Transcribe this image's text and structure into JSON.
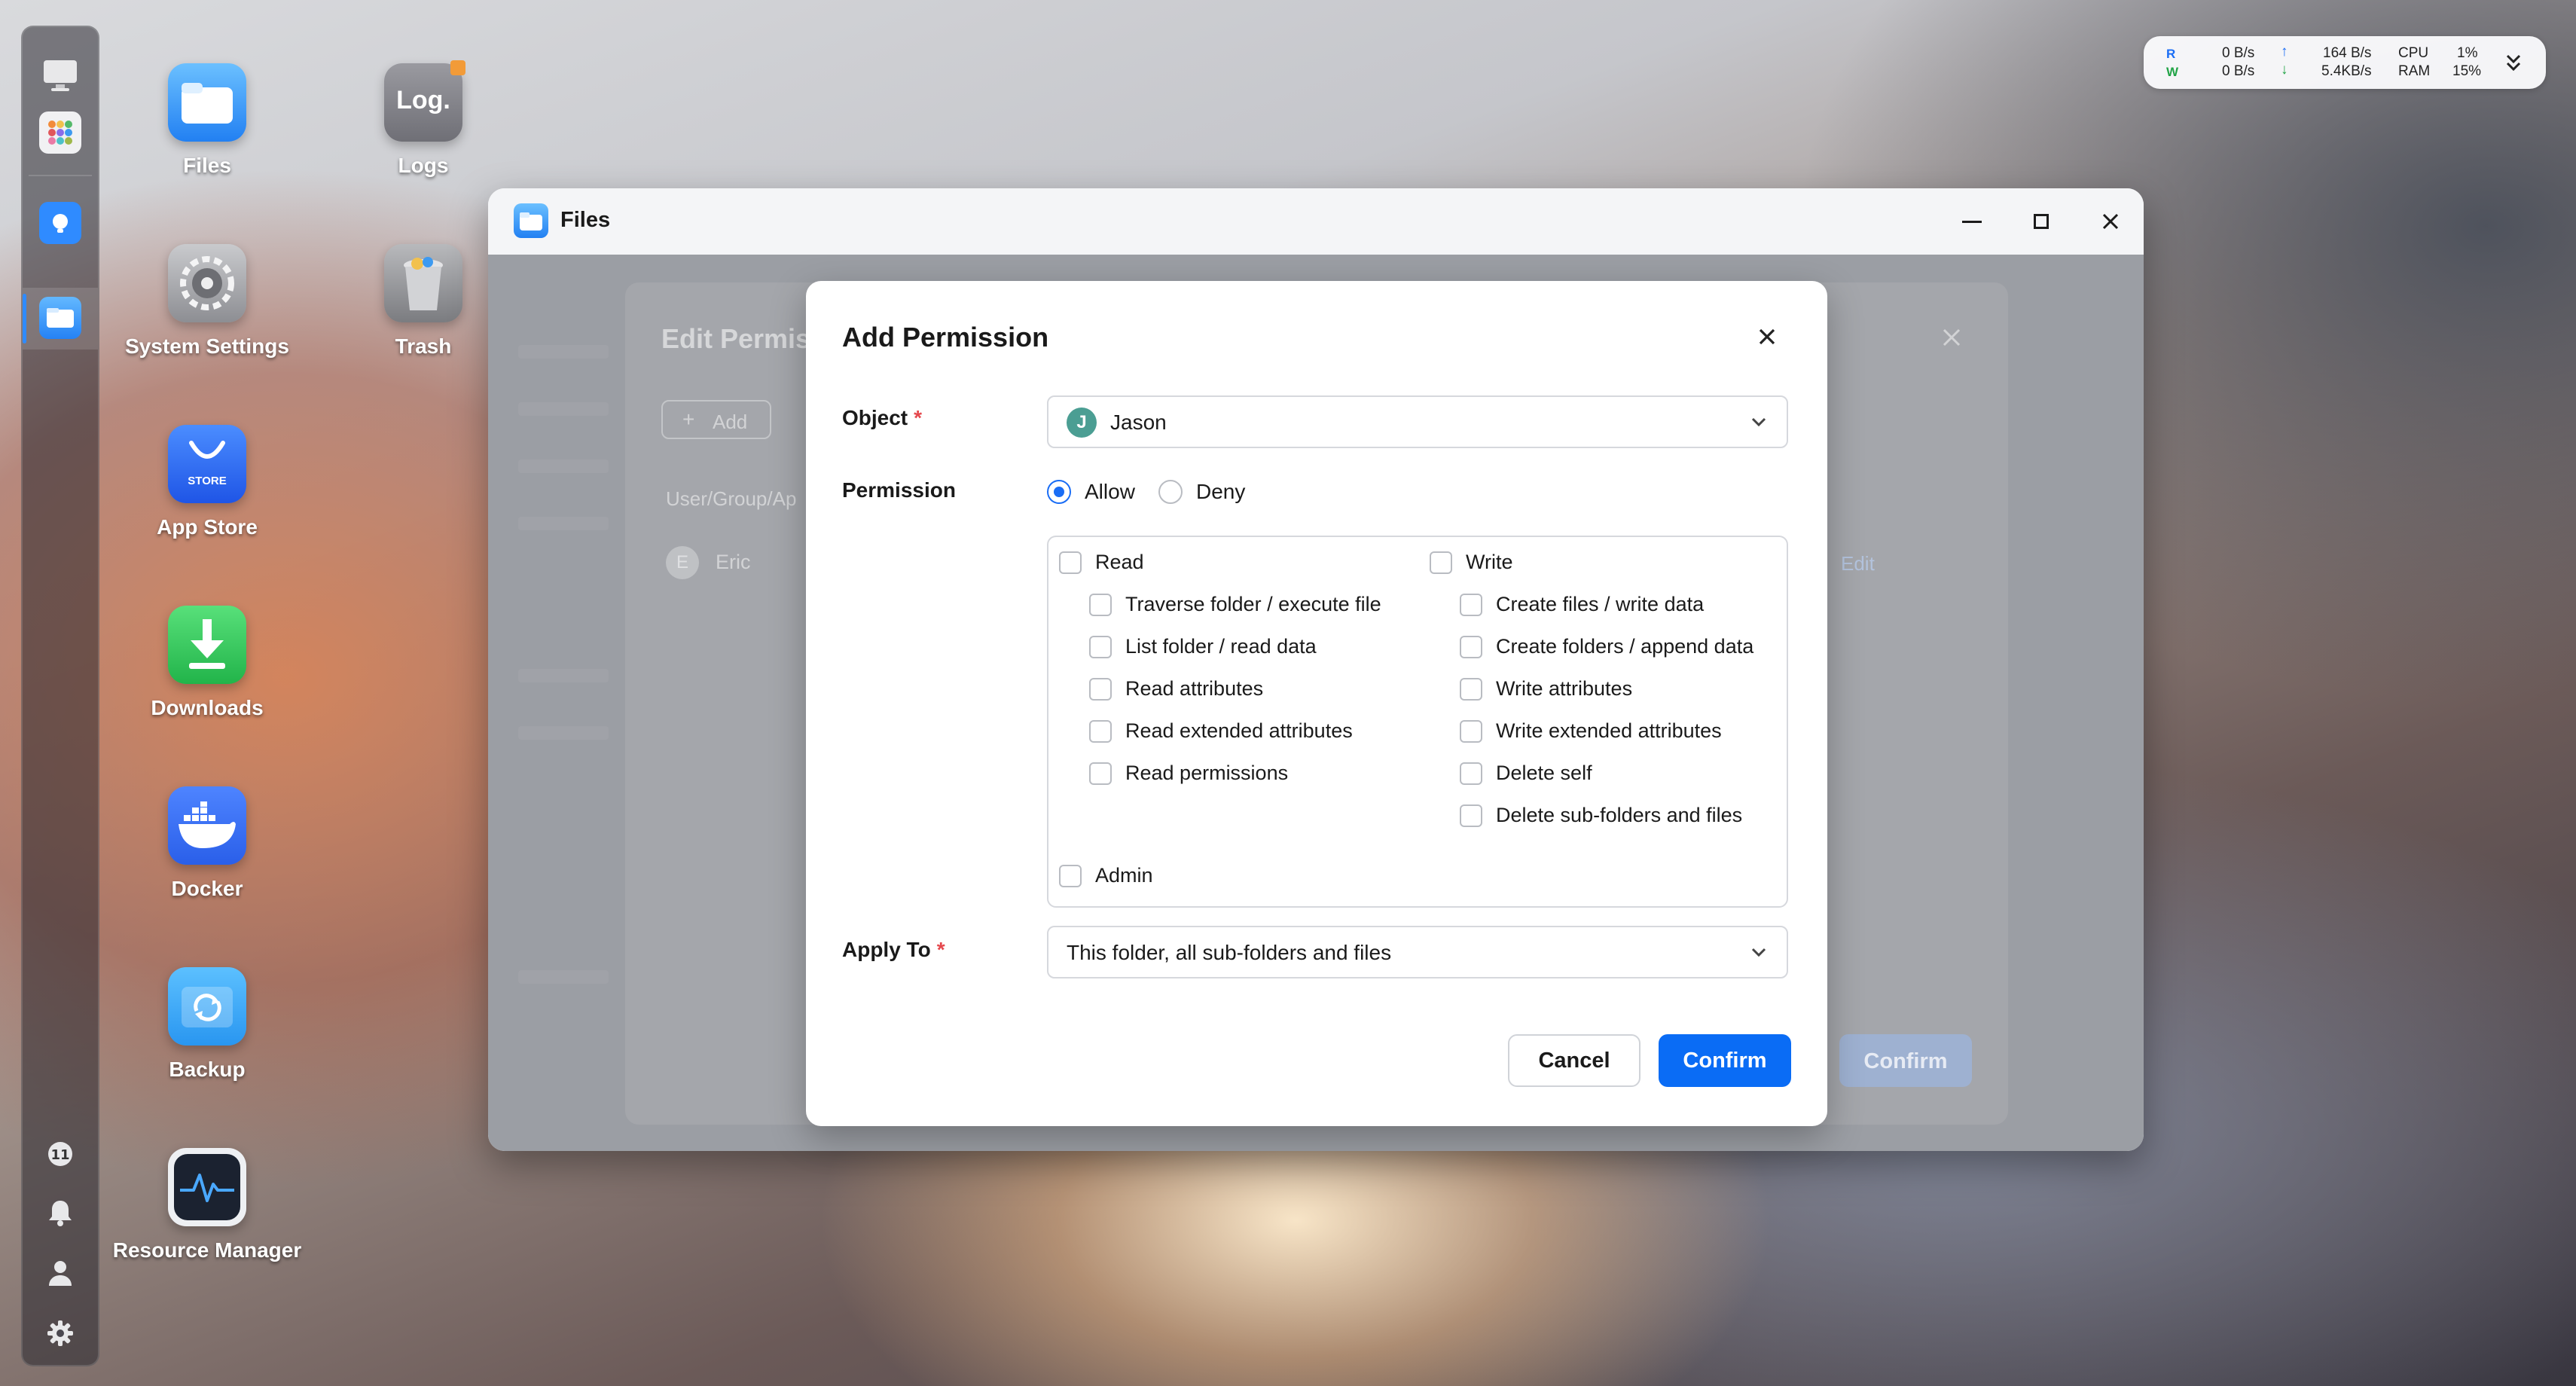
{
  "desktop": {
    "icons": [
      {
        "label": "Files"
      },
      {
        "label": "Logs"
      },
      {
        "label": "System Settings"
      },
      {
        "label": "Trash"
      },
      {
        "label": "App Store",
        "badge": "STORE"
      },
      {
        "label": "Downloads"
      },
      {
        "label": "Docker"
      },
      {
        "label": "Backup"
      },
      {
        "label": "Resource Manager"
      }
    ],
    "logs_tile_text": "Log."
  },
  "stats": {
    "r_label": "R",
    "w_label": "W",
    "r_value": "0 B/s",
    "w_value": "0 B/s",
    "up_value": "164 B/s",
    "down_value": "5.4KB/s",
    "cpu_label": "CPU",
    "ram_label": "RAM",
    "cpu_value": "1%",
    "ram_value": "15%"
  },
  "window": {
    "title": "Files"
  },
  "edit_dialog": {
    "title": "Edit Permis",
    "add_label": "Add",
    "column_header": "User/Group/Ap",
    "row_name": "Eric",
    "row_initial": "E",
    "edit_link": "Edit",
    "confirm_label": "Confirm"
  },
  "modal": {
    "title": "Add Permission",
    "object_label": "Object",
    "required_mark": "*",
    "object_value": "Jason",
    "object_initial": "J",
    "permission_label": "Permission",
    "allow_label": "Allow",
    "deny_label": "Deny",
    "selected_permission": "Allow",
    "read_label": "Read",
    "write_label": "Write",
    "read_items": [
      "Traverse folder / execute file",
      "List folder / read data",
      "Read attributes",
      "Read extended attributes",
      "Read permissions"
    ],
    "write_items": [
      "Create files / write data",
      "Create folders / append data",
      "Write attributes",
      "Write extended attributes",
      "Delete self",
      "Delete sub-folders and files"
    ],
    "admin_label": "Admin",
    "apply_to_label": "Apply To",
    "apply_to_value": "This folder, all sub-folders and files",
    "cancel_label": "Cancel",
    "confirm_label": "Confirm"
  },
  "colors": {
    "accent": "#0a6cf5",
    "required": "#e5484d"
  }
}
